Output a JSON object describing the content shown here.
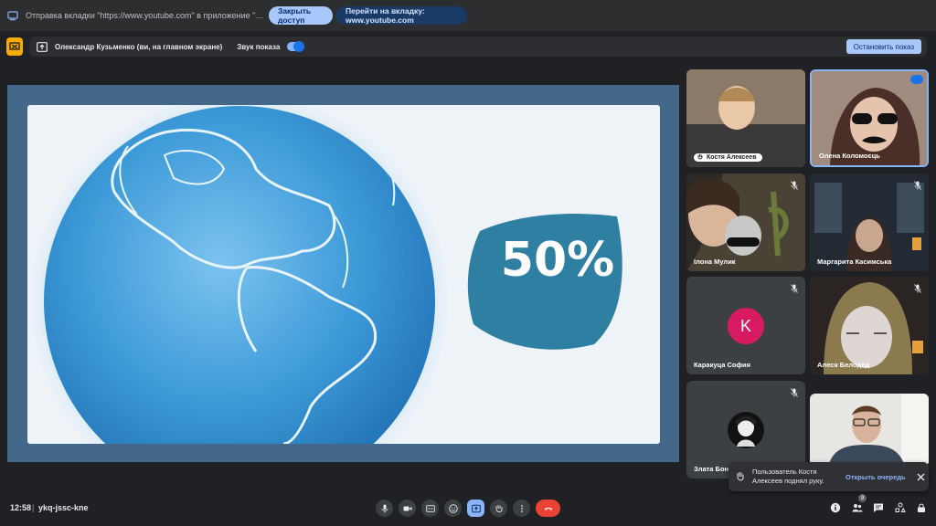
{
  "share_bar": {
    "text": "Отправка вкладки \"https://www.youtube.com\" в приложение \"meet.google.com\"...",
    "stop_label": "Закрыть доступ",
    "goto_label": "Перейти на вкладку: www.youtube.com"
  },
  "presenter_bar": {
    "presenter": "Олександр Кузьменко (ви, на главном экране)",
    "sound_label": "Звук показа",
    "sound_on": true,
    "stop_label": "Остановить показ"
  },
  "slide": {
    "percent": "50%"
  },
  "participants": [
    {
      "name": "Костя Алексеев",
      "muted": false,
      "raised_hand": true
    },
    {
      "name": "Олена Коломоєць",
      "muted": false,
      "speaking": true
    },
    {
      "name": "Ілона Мулик",
      "muted": true
    },
    {
      "name": "Маргарита Касимська",
      "muted": true
    },
    {
      "name": "Каракуца София",
      "muted": true,
      "avatar_letter": "K",
      "avatar_color": "#d81b60"
    },
    {
      "name": "Алеся Белодед",
      "muted": true
    },
    {
      "name": "Злата Бонд",
      "muted": true
    },
    {
      "name": "",
      "muted": false
    }
  ],
  "toast": {
    "message": "Пользователь Костя Алексеев поднял руку.",
    "action": "Открыть очередь"
  },
  "bottom_bar": {
    "time": "12:58",
    "separator": "|",
    "meeting_code": "ykq-jssc-kne",
    "people_count": "9"
  },
  "colors": {
    "accent": "#8ab4f8",
    "hangup": "#ea4335",
    "presenter_icon": "#f9ab00",
    "slide_teal": "#2f7fa3"
  },
  "icons": [
    "tab-share-icon",
    "present-icon",
    "screen-share-icon",
    "mic-icon",
    "camera-icon",
    "captions-icon",
    "emoji-icon",
    "present-now-icon",
    "raise-hand-icon",
    "more-options-icon",
    "hangup-icon",
    "info-icon",
    "people-icon",
    "chat-icon",
    "activities-icon",
    "lock-icon",
    "close-icon"
  ]
}
